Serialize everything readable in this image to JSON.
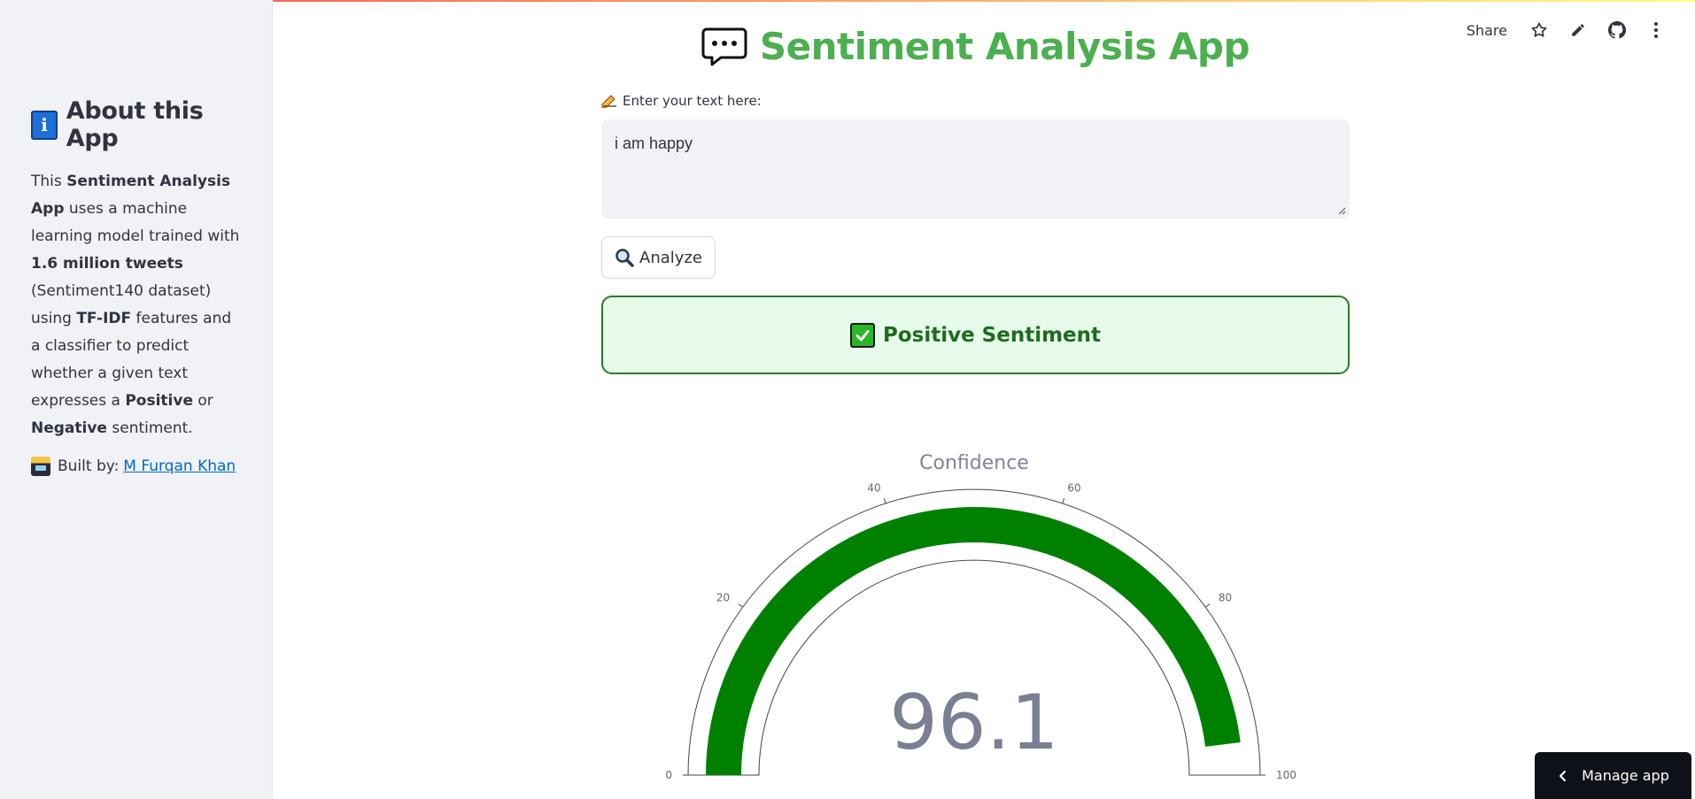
{
  "sidebar": {
    "title": "About this App",
    "body_parts": {
      "p1": "This ",
      "b1": "Sentiment Analysis App",
      "p2": " uses a machine learning model trained with ",
      "b2": "1.6 million tweets",
      "p3": " (Sentiment140 dataset) using ",
      "b3": "TF-IDF",
      "p4": " features and a classifier to predict whether a given text expresses a ",
      "b4": "Positive",
      "p5": " or ",
      "b5": "Negative",
      "p6": " sentiment."
    },
    "built_by_label": "Built by:",
    "author_link": "M Furqan Khan"
  },
  "toolbar": {
    "share_label": "Share",
    "icons": [
      "star-icon",
      "pencil-icon",
      "github-icon",
      "kebab-menu-icon"
    ]
  },
  "main": {
    "title": "Sentiment Analysis App",
    "input_label": "Enter your text here:",
    "input_value": "i am happy",
    "analyze_label": "Analyze",
    "result_text": "Positive Sentiment"
  },
  "gauge": {
    "title": "Confidence",
    "value": 96.1,
    "value_text": "96.1",
    "min": 0,
    "max": 100,
    "ticks": [
      "0",
      "20",
      "40",
      "60",
      "80",
      "100"
    ],
    "bar_color": "#008000"
  },
  "colors": {
    "title_green": "#4caf50",
    "result_bg": "#e6fbe9",
    "result_border": "#2b7a2b",
    "sidebar_bg": "#f0f2f6",
    "link": "#0068c9"
  },
  "manage_app": {
    "label": "Manage app"
  }
}
